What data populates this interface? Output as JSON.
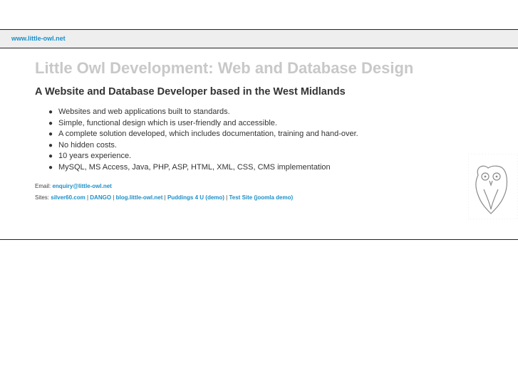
{
  "header": {
    "site_link": "www.little-owl.net"
  },
  "main": {
    "title": "Little Owl Development: Web and Database Design",
    "subtitle": "A Website and Database Developer based in the West Midlands",
    "features": [
      "Websites and web applications built to standards.",
      "Simple, functional design which is user-friendly and accessible.",
      "A complete solution developed, which includes documentation, training and hand-over.",
      "No hidden costs.",
      "10 years experience.",
      "MySQL, MS Access, Java, PHP, ASP, HTML, XML, CSS, CMS implementation"
    ],
    "email_label": "Email:",
    "email_address": "enquiry@little-owl.net",
    "sites_label": "Sites:",
    "sites": [
      "silver60.com",
      "DANGO",
      "blog.little-owl.net",
      "Puddings 4 U (demo)",
      "Test Site (joomla demo)"
    ],
    "separator": "|"
  },
  "logo": {
    "icon": "owl-icon"
  },
  "colors": {
    "link": "#1a8fc9",
    "title": "#c8c8c8",
    "text": "#333333",
    "bar": "#eeeeee"
  }
}
